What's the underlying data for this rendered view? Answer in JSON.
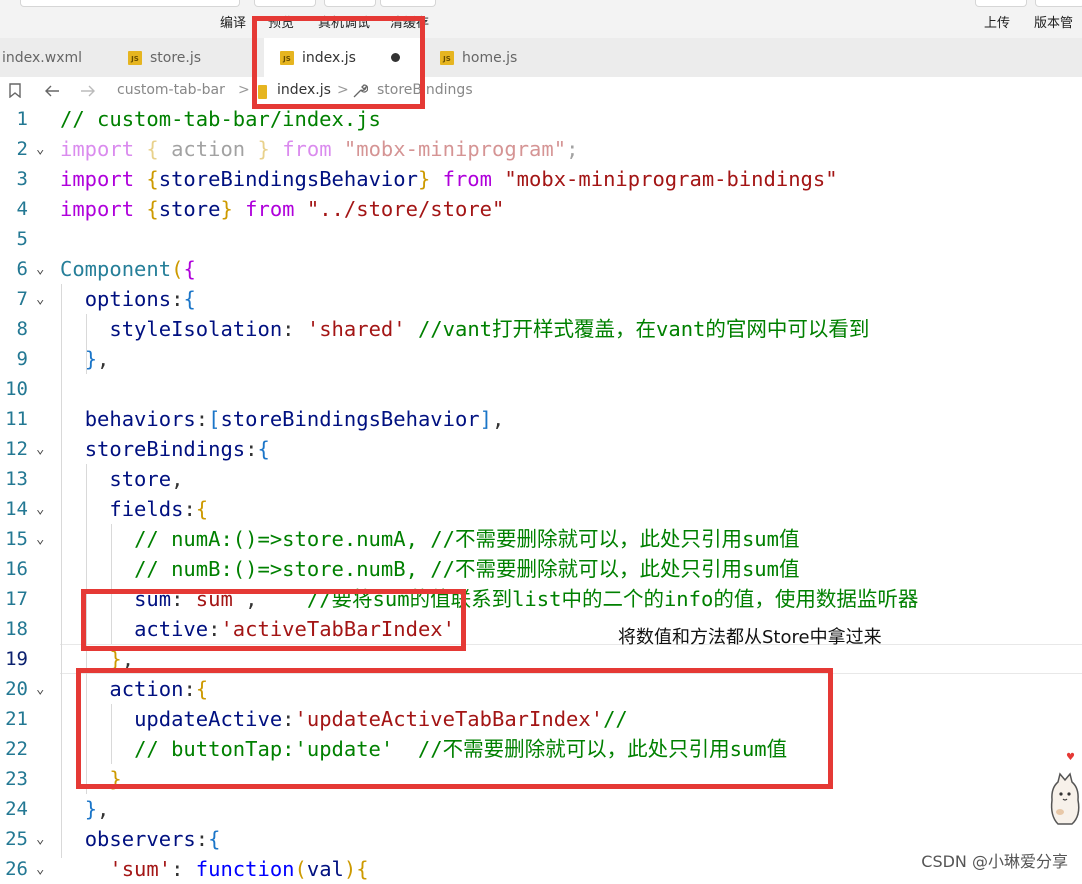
{
  "toolbar": {
    "left_labels": [
      "编译",
      "预览",
      "真机调试",
      "清缓存"
    ],
    "right_labels": [
      "上传",
      "版本管"
    ]
  },
  "tabs": [
    {
      "label": "index.wxml",
      "icon": null,
      "active": false
    },
    {
      "label": "store.js",
      "icon": "js-icon",
      "active": false
    },
    {
      "label": "index.js",
      "icon": "js-icon",
      "active": true,
      "modified": true
    },
    {
      "label": "home.js",
      "icon": "js-icon",
      "active": false
    }
  ],
  "breadcrumb": {
    "items": [
      "custom-tab-bar",
      "index.js",
      "storeBindings"
    ],
    "separator": ">",
    "icons": [
      "bookmark-icon",
      "back-arrow-icon",
      "forward-arrow-icon",
      "js-icon",
      "wrench-icon"
    ]
  },
  "code": {
    "lines": [
      {
        "n": "1",
        "fold": false,
        "segs": [
          [
            "com",
            "// custom-tab-bar/index.js"
          ]
        ]
      },
      {
        "n": "2",
        "fold": true,
        "segs": [
          [
            "kw faded",
            "import"
          ],
          [
            "faded",
            " "
          ],
          [
            "br1 faded",
            "{"
          ],
          [
            "faded",
            " action "
          ],
          [
            "br1 faded",
            "}"
          ],
          [
            "faded",
            " "
          ],
          [
            "kw faded",
            "from"
          ],
          [
            "faded",
            " "
          ],
          [
            "str faded",
            "\"mobx-miniprogram\""
          ],
          [
            "faded",
            ";"
          ]
        ]
      },
      {
        "n": "3",
        "fold": false,
        "segs": [
          [
            "kw",
            "import"
          ],
          [
            "",
            " "
          ],
          [
            "br1",
            "{"
          ],
          [
            "prop",
            "storeBindingsBehavior"
          ],
          [
            "br1",
            "}"
          ],
          [
            "",
            " "
          ],
          [
            "kw",
            "from"
          ],
          [
            "",
            " "
          ],
          [
            "str",
            "\"mobx-miniprogram-bindings\""
          ]
        ]
      },
      {
        "n": "4",
        "fold": false,
        "segs": [
          [
            "kw",
            "import"
          ],
          [
            "",
            " "
          ],
          [
            "br1",
            "{"
          ],
          [
            "prop",
            "store"
          ],
          [
            "br1",
            "}"
          ],
          [
            "",
            " "
          ],
          [
            "kw",
            "from"
          ],
          [
            "",
            " "
          ],
          [
            "str",
            "\"../store/store\""
          ]
        ]
      },
      {
        "n": "5",
        "fold": false,
        "segs": []
      },
      {
        "n": "6",
        "fold": true,
        "segs": [
          [
            "cls",
            "Component"
          ],
          [
            "br1",
            "("
          ],
          [
            "br2",
            "{"
          ]
        ]
      },
      {
        "n": "7",
        "fold": true,
        "segs": [
          [
            "",
            "  "
          ],
          [
            "prop",
            "options"
          ],
          [
            "",
            ":"
          ],
          [
            "br3",
            "{"
          ]
        ]
      },
      {
        "n": "8",
        "fold": false,
        "segs": [
          [
            "",
            "    "
          ],
          [
            "prop",
            "styleIsolation"
          ],
          [
            "",
            ": "
          ],
          [
            "str",
            "'shared'"
          ],
          [
            "",
            " "
          ],
          [
            "com",
            "//vant打开样式覆盖，在vant的官网中可以看到"
          ]
        ]
      },
      {
        "n": "9",
        "fold": false,
        "segs": [
          [
            "",
            "  "
          ],
          [
            "br3",
            "}"
          ],
          [
            "",
            ","
          ]
        ]
      },
      {
        "n": "10",
        "fold": false,
        "segs": []
      },
      {
        "n": "11",
        "fold": false,
        "segs": [
          [
            "",
            "  "
          ],
          [
            "prop",
            "behaviors"
          ],
          [
            "",
            ":"
          ],
          [
            "br3",
            "["
          ],
          [
            "prop",
            "storeBindingsBehavior"
          ],
          [
            "br3",
            "]"
          ],
          [
            "",
            ","
          ]
        ]
      },
      {
        "n": "12",
        "fold": true,
        "segs": [
          [
            "",
            "  "
          ],
          [
            "prop",
            "storeBindings"
          ],
          [
            "",
            ":"
          ],
          [
            "br3",
            "{"
          ]
        ]
      },
      {
        "n": "13",
        "fold": false,
        "segs": [
          [
            "",
            "    "
          ],
          [
            "prop",
            "store"
          ],
          [
            "",
            ","
          ]
        ]
      },
      {
        "n": "14",
        "fold": true,
        "segs": [
          [
            "",
            "    "
          ],
          [
            "prop",
            "fields"
          ],
          [
            "",
            ":"
          ],
          [
            "br1",
            "{"
          ]
        ]
      },
      {
        "n": "15",
        "fold": true,
        "segs": [
          [
            "",
            "      "
          ],
          [
            "com",
            "// numA:()=>store.numA, //不需要删除就可以，此处只引用sum值"
          ]
        ]
      },
      {
        "n": "16",
        "fold": false,
        "segs": [
          [
            "",
            "      "
          ],
          [
            "com",
            "// numB:()=>store.numB, //不需要删除就可以，此处只引用sum值"
          ]
        ]
      },
      {
        "n": "17",
        "fold": false,
        "segs": [
          [
            "",
            "      "
          ],
          [
            "prop",
            "sum"
          ],
          [
            "",
            ": "
          ],
          [
            "str",
            "sum"
          ],
          [
            "",
            " ,    "
          ],
          [
            "com",
            "//要将sum的值联系到list中的二个的info的值，使用数据监听器"
          ]
        ]
      },
      {
        "n": "18",
        "fold": false,
        "segs": [
          [
            "",
            "      "
          ],
          [
            "prop",
            "active"
          ],
          [
            "",
            ":"
          ],
          [
            "str",
            "'activeTabBarIndex'"
          ]
        ]
      },
      {
        "n": "19",
        "fold": false,
        "segs": [
          [
            "",
            "    "
          ],
          [
            "br1",
            "}"
          ],
          [
            "",
            ","
          ]
        ]
      },
      {
        "n": "20",
        "fold": true,
        "segs": [
          [
            "",
            "    "
          ],
          [
            "prop",
            "action"
          ],
          [
            "",
            ":"
          ],
          [
            "br1",
            "{"
          ]
        ]
      },
      {
        "n": "21",
        "fold": false,
        "segs": [
          [
            "",
            "      "
          ],
          [
            "prop",
            "updateActive"
          ],
          [
            "",
            ":"
          ],
          [
            "str",
            "'updateActiveTabBarIndex'"
          ],
          [
            "com",
            "//"
          ]
        ]
      },
      {
        "n": "22",
        "fold": false,
        "segs": [
          [
            "",
            "      "
          ],
          [
            "com",
            "// buttonTap:'update'  //不需要删除就可以，此处只引用sum值"
          ]
        ]
      },
      {
        "n": "23",
        "fold": false,
        "segs": [
          [
            "",
            "    "
          ],
          [
            "br1",
            "}"
          ]
        ]
      },
      {
        "n": "24",
        "fold": false,
        "segs": [
          [
            "",
            "  "
          ],
          [
            "br3",
            "}"
          ],
          [
            "",
            ","
          ]
        ]
      },
      {
        "n": "25",
        "fold": true,
        "segs": [
          [
            "",
            "  "
          ],
          [
            "prop",
            "observers"
          ],
          [
            "",
            ":"
          ],
          [
            "br3",
            "{"
          ]
        ]
      },
      {
        "n": "26",
        "fold": true,
        "segs": [
          [
            "",
            "    "
          ],
          [
            "str",
            "'sum'"
          ],
          [
            "",
            ": "
          ],
          [
            "kw2",
            "function"
          ],
          [
            "br1",
            "("
          ],
          [
            "prop",
            "val"
          ],
          [
            "br1",
            ")"
          ],
          [
            "br1",
            "{"
          ]
        ]
      }
    ]
  },
  "annotation": "将数值和方法都从Store中拿过来",
  "watermark": "CSDN @小琳爱分享",
  "colors": {
    "highlight": "#e53935",
    "comment": "#008000",
    "keyword": "#af00db",
    "string": "#a31515",
    "line_number": "#237893"
  }
}
